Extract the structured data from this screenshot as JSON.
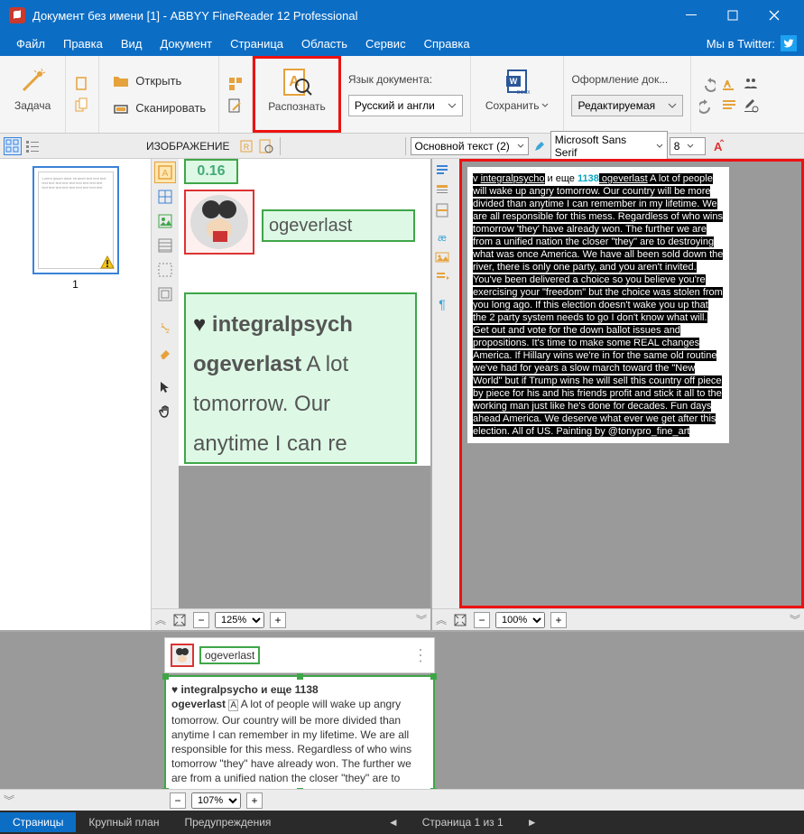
{
  "title": "Документ без имени [1] - ABBYY FineReader 12 Professional",
  "menu": {
    "file": "Файл",
    "edit": "Правка",
    "view": "Вид",
    "document": "Документ",
    "page": "Страница",
    "area": "Область",
    "service": "Сервис",
    "help": "Справка",
    "twitter": "Мы в Twitter:"
  },
  "ribbon": {
    "task": "Задача",
    "open": "Открыть",
    "scan": "Сканировать",
    "recognize": "Распознать",
    "lang_label": "Язык документа:",
    "lang_value": "Русский и англи",
    "save": "Сохранить",
    "design": "Оформление док...",
    "design_value": "Редактируемая"
  },
  "tb2": {
    "image_label": "ИЗОБРАЖЕНИЕ",
    "main_text": "Основной текст (2)",
    "font": "Microsoft Sans Serif",
    "size": "8"
  },
  "pages": {
    "num": "1"
  },
  "img_zoom": "125%",
  "text_zoom": "100%",
  "bottom_zoom": "107%",
  "image_sample": {
    "timestamp": "0.16",
    "username": "ogeverlast",
    "line1": "integralpsych",
    "line2": "ogeverlast",
    "line2b": "A lot",
    "line3": "tomorrow. Our",
    "line4": "anytime I can re"
  },
  "text_page": {
    "pre": "v ",
    "a": "integralpsycho",
    "mid": " и еще ",
    "num": "1138",
    "og": " ogeverlast",
    "rest": " A lot of people will wake up angry tomorrow. Our country will be more divided than anytime I can remember in my lifetime. We are all responsible for this mess. Regardless of who wins tomorrow 'they' have already won. The further we are from a unified nation the closer \"they\" are to destroying what was once America. We have all been sold down the river, there is only one party, and you aren't invited. You've been delivered a choice so you believe you're exercising your \"freedom\" but the choice was stolen from you long ago. If this election doesn't wake you up that the 2 party system needs to go I don't know what will. Get out and vote for the down ballot issues and propositions. It's time to make some REAL changes America. If Hillary wins we're in for the same old routine we've had for years a slow march toward the \"New World\" but if Trump wins he will sell this country off piece by piece for his and his friends profit and stick it all to the working man just like he's done for decades. Fun days ahead America. We deserve what ever we get after this election. All of US. Painting by @tonypro_fine_art"
  },
  "bottom": {
    "user": "ogeverlast",
    "heart_line": "integralpsycho и еще 1138",
    "body_user": "ogeverlast ",
    "body": "A lot of people will wake up angry tomorrow. Our country will be more divided than anytime I can remember in my lifetime. We are all responsible for this mess. Regardless of who wins tomorrow \"they\" have already won. The further we are from a unified nation the closer \"they\" are to"
  },
  "status": {
    "pages": "Страницы",
    "closeup": "Крупный план",
    "warnings": "Предупреждения",
    "pager": "Страница 1 из 1"
  }
}
